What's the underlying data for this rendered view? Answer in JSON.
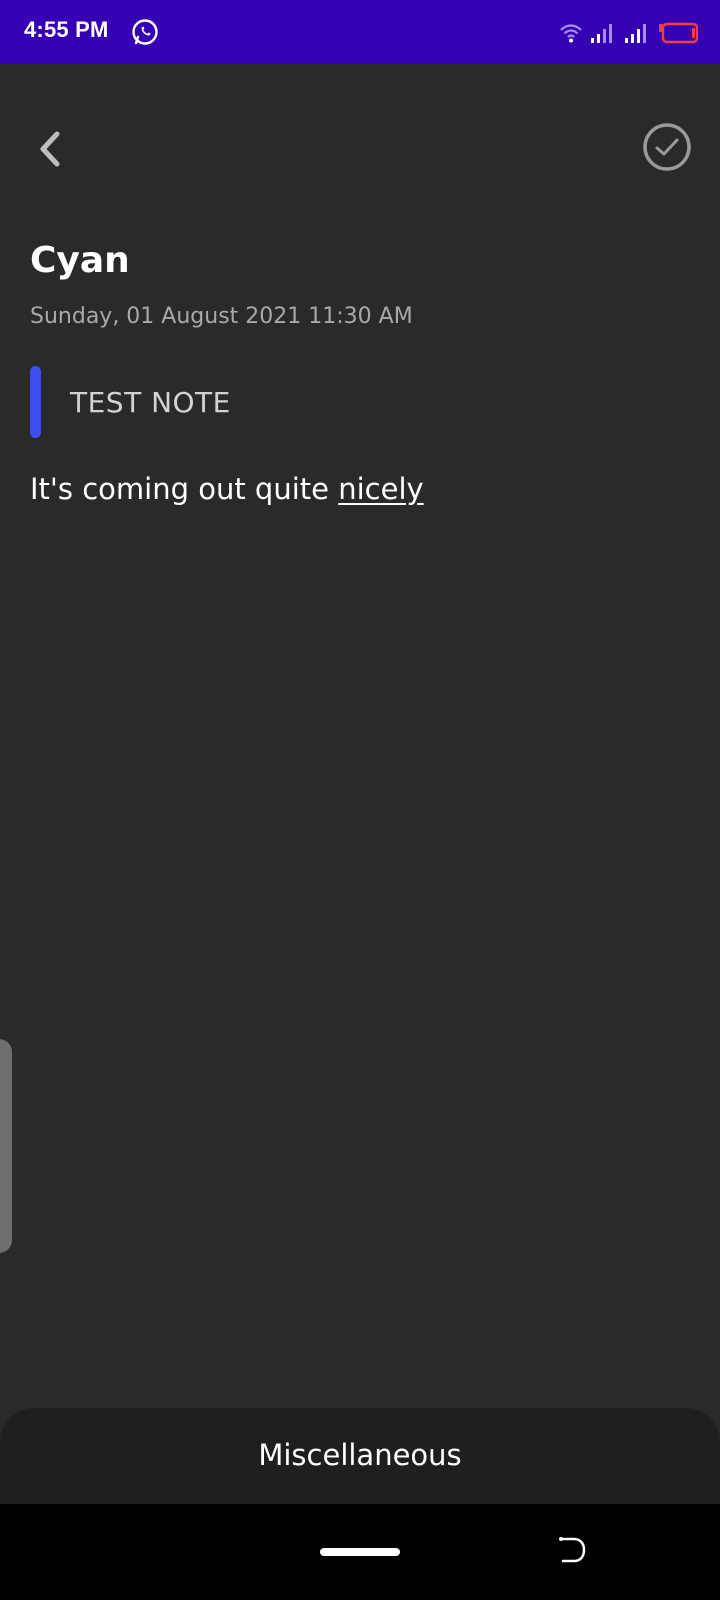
{
  "status_bar": {
    "time": "4:55 PM",
    "icons": [
      "whatsapp-icon",
      "wifi-icon",
      "signal-icon",
      "signal-icon",
      "battery-low-icon"
    ],
    "background_color": "#3600b3",
    "battery_color": "#ff3b3b"
  },
  "toolbar": {
    "back_icon": "chevron-left-icon",
    "done_icon": "check-circle-icon"
  },
  "note": {
    "title": "Cyan",
    "date": "Sunday, 01 August 2021 11:30 AM",
    "subtitle": "TEST NOTE",
    "accent_color": "#3d4ef0",
    "body_prefix": "It's coming out quite ",
    "body_underlined": "nicely"
  },
  "bottom_sheet": {
    "category": "Miscellaneous"
  },
  "navigation": {
    "home_icon": "home-pill-icon",
    "back_icon": "back-gesture-icon"
  }
}
